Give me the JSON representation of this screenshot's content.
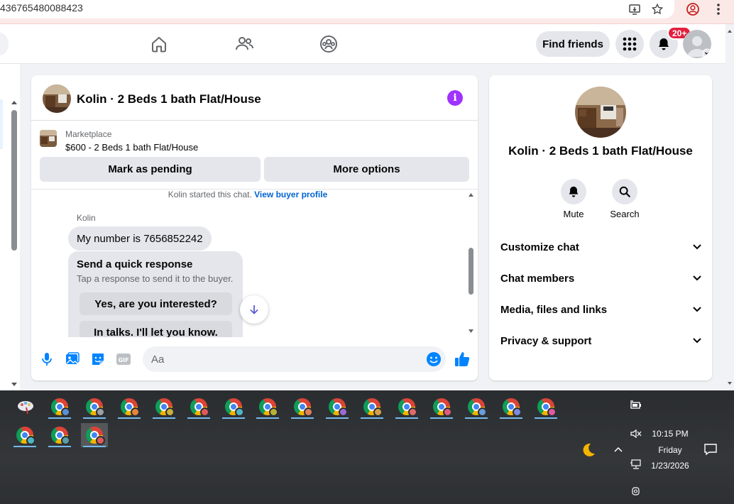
{
  "browser": {
    "url_fragment": "436765480088423",
    "icons": [
      "install-app-icon",
      "bookmark-star-icon",
      "profile-icon",
      "menu-kebab-icon"
    ]
  },
  "nav": {
    "icons": [
      "home-icon",
      "friends-icon",
      "groups-icon"
    ],
    "find_friends_label": "Find friends",
    "notification_count": "20+"
  },
  "chat": {
    "title": "Kolin · 2 Beds 1 bath Flat/House",
    "marketplace_label": "Marketplace",
    "listing_line": "$600 - 2 Beds 1 bath Flat/House",
    "mark_pending_label": "Mark as pending",
    "more_options_label": "More options",
    "started_text": "Kolin started this chat.",
    "view_buyer_link": "View buyer profile",
    "sender_name": "Kolin",
    "message": "My number is 7656852242",
    "quick_response": {
      "title": "Send a quick response",
      "subtitle": "Tap a response to send it to the buyer.",
      "options": [
        "Yes, are you interested?",
        "In talks. I'll let you know."
      ]
    },
    "composer": {
      "placeholder": "Aa",
      "icons": [
        "microphone-icon",
        "photo-icon",
        "sticker-icon",
        "gif-icon",
        "emoji-icon",
        "thumbs-up-icon"
      ]
    }
  },
  "info_panel": {
    "title": "Kolin · 2 Beds 1 bath Flat/House",
    "actions": [
      {
        "label": "Mute",
        "icon": "bell-icon"
      },
      {
        "label": "Search",
        "icon": "search-icon"
      }
    ],
    "sections": [
      "Customize chat",
      "Chat members",
      "Media, files and links",
      "Privacy & support"
    ]
  },
  "taskbar": {
    "time": "10:15 PM",
    "day": "Friday",
    "date": "1/23/2026",
    "profile_colors_row1": [
      "#5b8fd6",
      "#9aa0a6",
      "#e8853d",
      "#c9b13b",
      "#e05a5a",
      "#4db6c4",
      "#b8b03a",
      "#e0805a",
      "#9c6ad6",
      "#d4a04a",
      "#e06a6a",
      "#e05a7a",
      "#6a9ce0",
      "#7a8ae0",
      "#e05aa0"
    ],
    "profile_colors_row2": [
      "#4db6c4",
      "#5aa0a8",
      "#e05a5a"
    ]
  },
  "colors": {
    "accent_purple": "#a033ff",
    "messenger_blue": "#0084ff",
    "badge_red": "#e41e3f",
    "link_blue": "#0064d1"
  }
}
